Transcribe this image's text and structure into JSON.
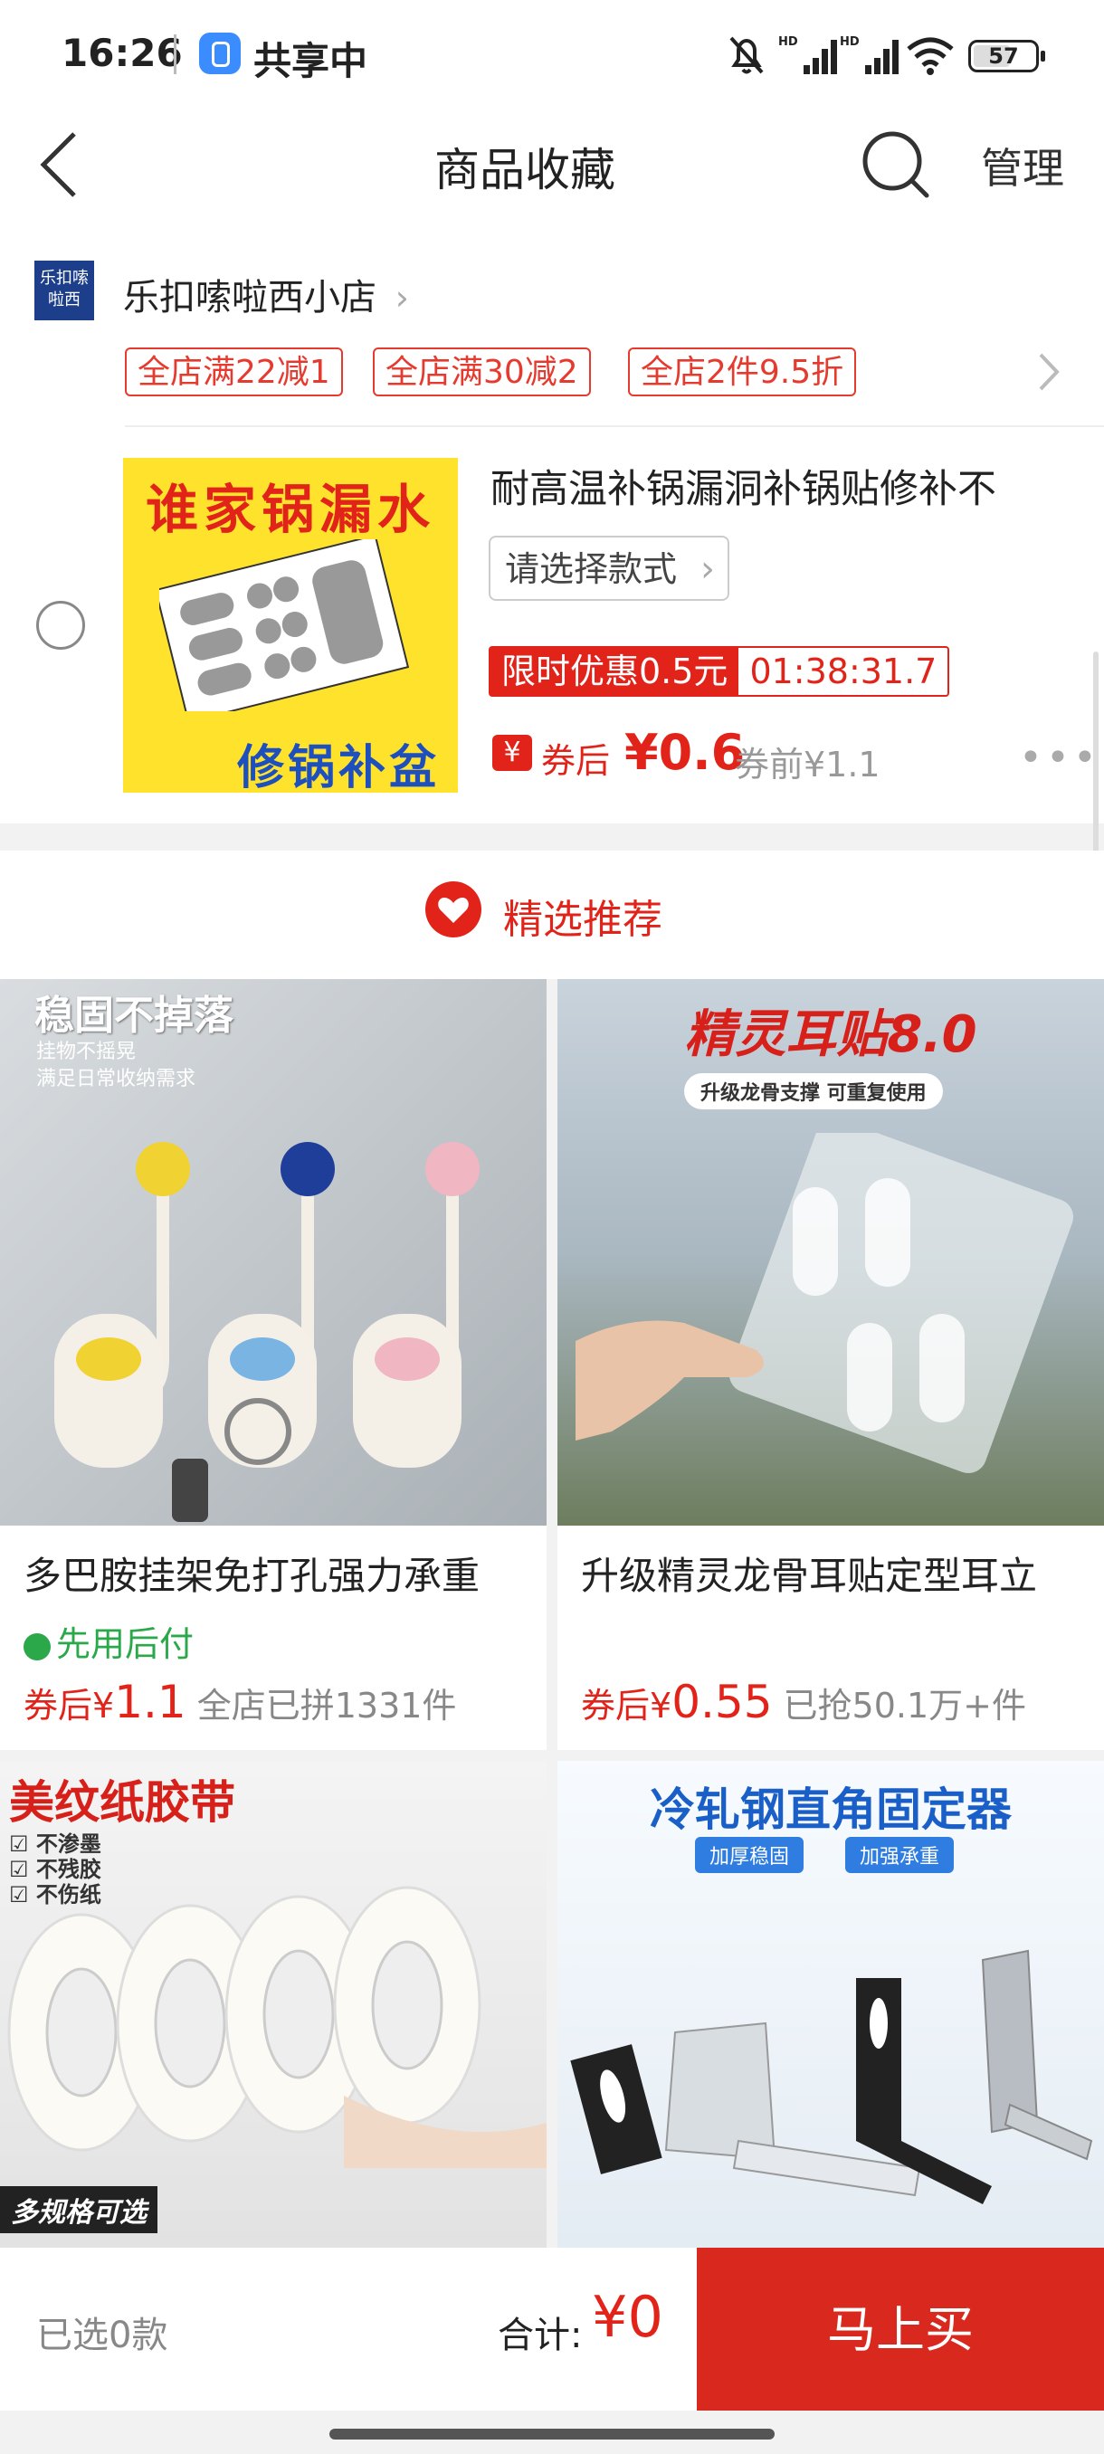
{
  "status_bar": {
    "time": "16:26",
    "share_label": "共享中",
    "battery": "57"
  },
  "nav": {
    "title": "商品收藏",
    "manage": "管理"
  },
  "shop": {
    "logo_text": "乐扣嗦啦西",
    "name": "乐扣嗦啦西小店",
    "tags": [
      "全店满22减1",
      "全店满30减2",
      "全店2件9.5折"
    ]
  },
  "favorite_item": {
    "image_top_text": "谁家锅漏水",
    "image_bottom_text": "修锅补盆",
    "title": "耐高温补锅漏洞补锅贴修补不",
    "variant_select": "请选择款式",
    "promo_label": "限时优惠0.5元",
    "promo_timer": "01:38:31.7",
    "coupon_icon": "¥",
    "after_coupon_label": "券后",
    "after_coupon_price": "¥0.6",
    "before_coupon": "券前¥1.1"
  },
  "recommend": {
    "title": "精选推荐",
    "products": [
      {
        "image_headline": "稳固不掉落",
        "image_subline1": "挂物不摇晃",
        "image_subline2": "满足日常收纳需求",
        "title": "多巴胺挂架免打孔强力承重",
        "pay_later": "先用后付",
        "price_label": "券后¥",
        "price": "1.1",
        "sales": "全店已拼1331件"
      },
      {
        "image_headline": "精灵耳贴8.0",
        "image_subline1": "升级龙骨支撑 可重复使用",
        "title": "升级精灵龙骨耳贴定型耳立",
        "price_label": "券后¥",
        "price": "0.55",
        "sales": "已抢50.1万+件"
      },
      {
        "image_headline": "美纹纸胶带",
        "image_subline1": "不渗墨",
        "image_subline2": "不残胶",
        "image_subline3": "不伤纸",
        "image_badge": "多规格可选"
      },
      {
        "image_headline": "冷轧钢直角固定器",
        "image_subline1": "加厚稳固",
        "image_subline2": "加强承重"
      }
    ]
  },
  "bottom": {
    "selected": "已选0款",
    "total_label": "合计:",
    "total_value": "¥0",
    "buy": "马上买"
  }
}
